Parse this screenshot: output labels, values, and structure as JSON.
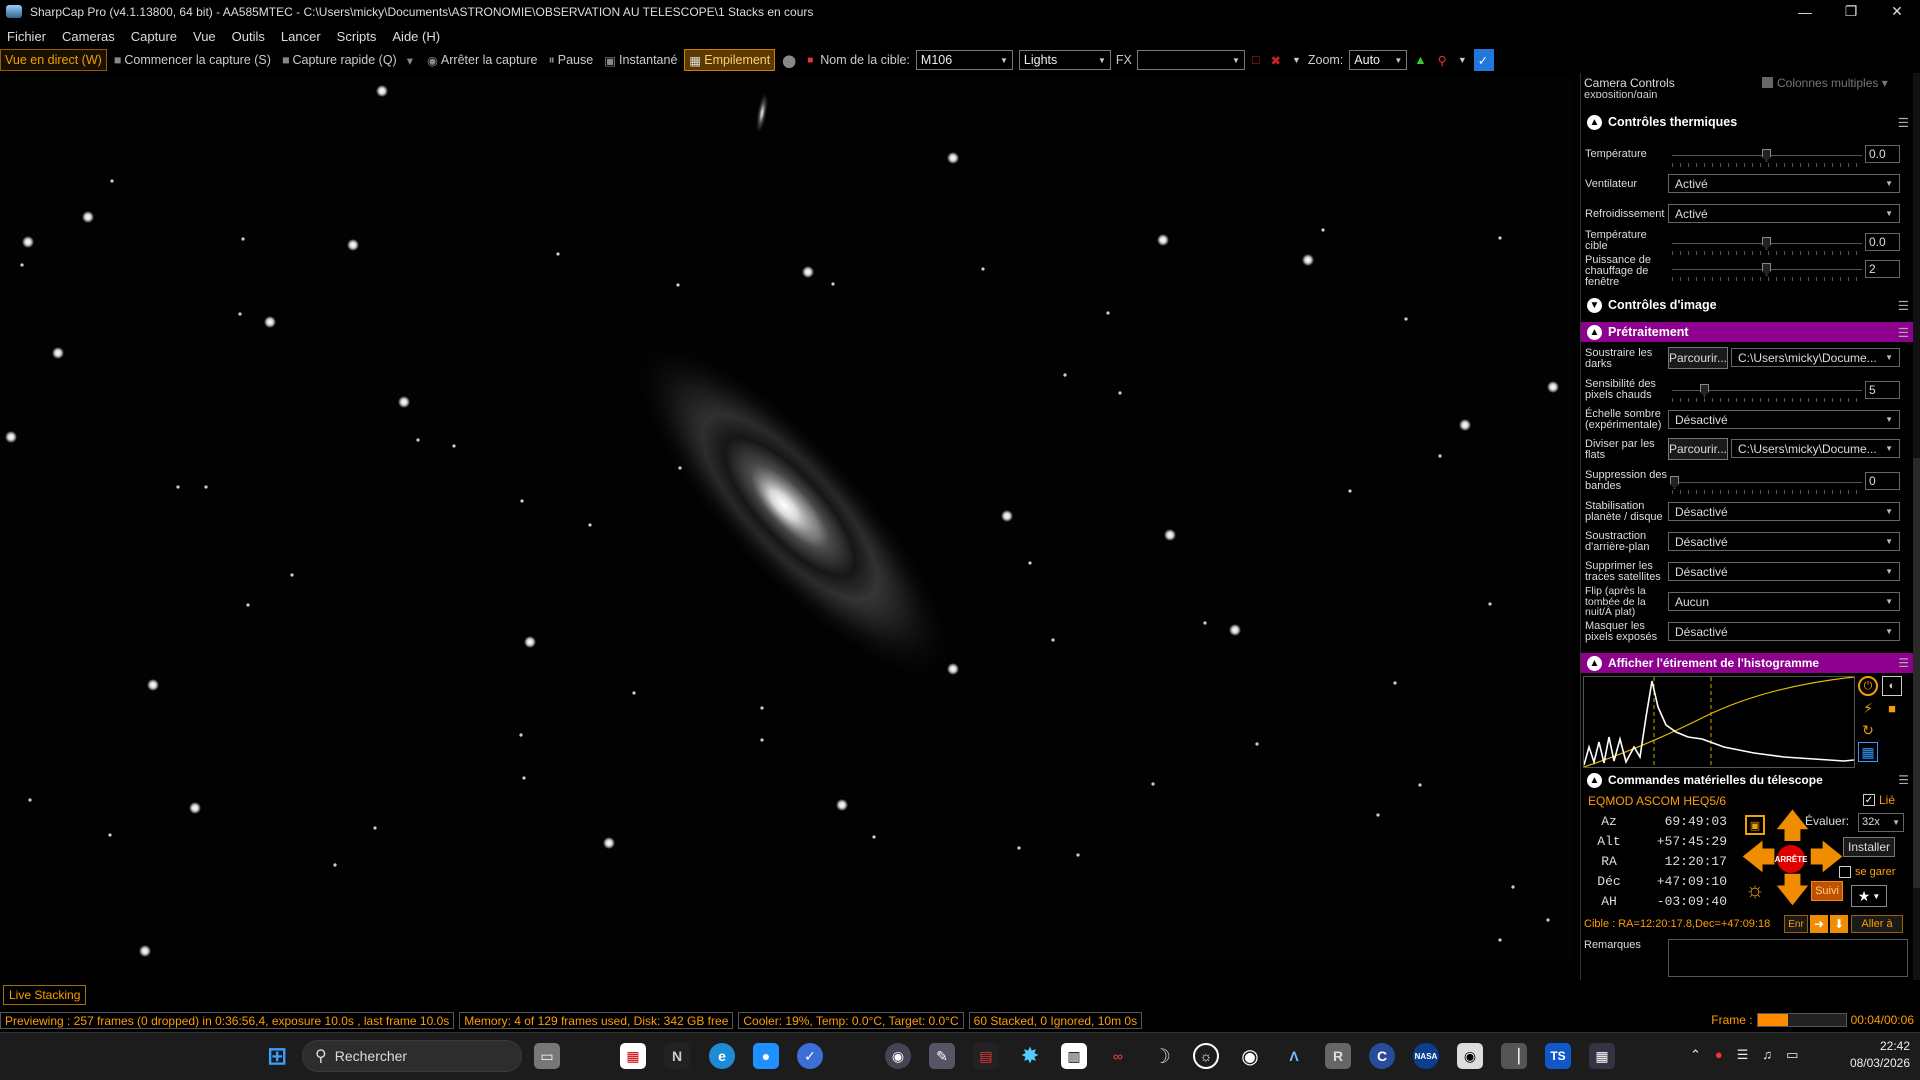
{
  "window": {
    "title": "SharpCap Pro (v4.1.13800, 64 bit) - AA585MTEC - C:\\Users\\micky\\Documents\\ASTRONOMIE\\OBSERVATION AU TELESCOPE\\1 Stacks en cours"
  },
  "menu": [
    "Fichier",
    "Cameras",
    "Capture",
    "Vue",
    "Outils",
    "Lancer",
    "Scripts",
    "Aide (H)"
  ],
  "toolbar": {
    "live": "Vue en direct (W)",
    "start": "Commencer la capture (S)",
    "quick": "Capture rapide (Q)",
    "stop": "Arrêter la capture",
    "pause": "Pause",
    "snapshot": "Instantané",
    "stacking": "Empilement",
    "target_label": "Nom de la cible:",
    "target": "M106",
    "frame_type": "Lights",
    "fx": "FX",
    "fx_value": "",
    "zoom_label": "Zoom:",
    "zoom": "Auto"
  },
  "bottom_tab": "Live Stacking",
  "status": {
    "preview": "Previewing : 257 frames (0 dropped) in 0:36:56,4, exposure 10.0s , last frame 10.0s",
    "memory": "Memory: 4 of 129 frames used, Disk: 342 GB free",
    "cooler": "Cooler: 19%, Temp: 0.0°C, Target: 0.0°C",
    "stacked": "60 Stacked, 0 Ignored, 10m 0s",
    "frame_label": "Frame :",
    "frame_progress": 0.35,
    "frame_time": "00:04/00:06"
  },
  "panel": {
    "title": "Camera Controls",
    "multi": "Colonnes multiples",
    "cut_label": "exposition/gain",
    "thermal": {
      "header": "Contrôles thermiques",
      "temp_label": "Température",
      "temp_value": "0.0",
      "fan_label": "Ventilateur",
      "fan_value": "Activé",
      "cool_label": "Refroidissement",
      "cool_value": "Activé",
      "target_label": "Température cible",
      "target_value": "0.0",
      "heat_label": "Puissance de chauffage de fenêtre",
      "heat_value": "2"
    },
    "image": {
      "header": "Contrôles d'image"
    },
    "pre": {
      "header": "Prétraitement",
      "dark_label": "Soustraire les darks",
      "browse": "Parcourir...",
      "dark_path": "C:\\Users\\micky\\Docume...",
      "hot_label": "Sensibilité des pixels chauds",
      "hot_value": "5",
      "dscale_label": "Échelle sombre (expérimentale)",
      "dscale_value": "Désactivé",
      "flat_label": "Diviser par les flats",
      "flat_path": "C:\\Users\\micky\\Docume...",
      "band_label": "Suppression des bandes",
      "band_value": "0",
      "stab_label": "Stabilisation planète / disque",
      "stab_value": "Désactivé",
      "bg_label": "Soustraction d'arrière-plan",
      "bg_value": "Désactivé",
      "sat_label": "Supprimer les traces satellites",
      "sat_value": "Désactivé",
      "flip_label": "Flip (après la tombée de la nuit/À plat)",
      "flip_value": "Aucun",
      "mask_label": "Masquer les pixels exposés",
      "mask_value": "Désactivé"
    },
    "histo": {
      "header": "Afficher l'étirement de l'histogramme"
    },
    "mount": {
      "header": "Commandes matérielles du télescope",
      "name": "EQMOD ASCOM HEQ5/6",
      "linked": "Lié",
      "az_l": "Az",
      "az": "69:49:03",
      "alt_l": "Alt",
      "alt": "+57:45:29",
      "ra_l": "RA",
      "ra": "12:20:17",
      "dec_l": "Déc",
      "dec": "+47:09:10",
      "ah_l": "AH",
      "ah": "-03:09:40",
      "rate_label": "Évaluer:",
      "rate": "32x",
      "install": "Installer",
      "park": "se garer",
      "stop": "ARRÊTE",
      "track": "Suivi",
      "target": "Cible : RA=12:20:17.8,Dec=+47:09:18",
      "en": "Enr",
      "goto": "Aller à"
    },
    "notes_label": "Remarques"
  },
  "taskbar": {
    "search": "Rechercher",
    "time": "22:42",
    "date": "08/03/2026"
  },
  "colors": {
    "accent": "#ff9d00",
    "purple": "#8e008e"
  }
}
